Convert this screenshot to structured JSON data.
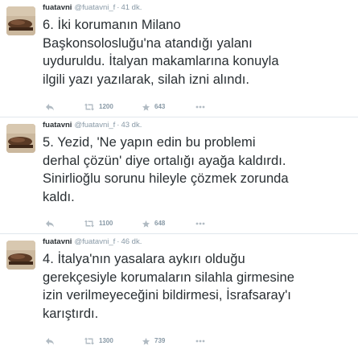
{
  "tweets": [
    {
      "fullname": "fuatavni",
      "username": "@fuatavni_f",
      "separator": "·",
      "time": "41 dk.",
      "text_lines": [
        "6. İki korumanın Milano",
        "Başkonsolosluğu'na atandığı yalanı",
        "uyduruldu. İtalyan makamlarına konuyla",
        "ilgili yazı yazılarak, silah izni alındı."
      ],
      "retweets": "1200",
      "favorites": "643"
    },
    {
      "fullname": "fuatavni",
      "username": "@fuatavni_f",
      "separator": "·",
      "time": "43 dk.",
      "text_lines": [
        "5. Yezid, 'Ne yapın edin bu problemi",
        "derhal çözün' diye ortalığı ayağa kaldırdı.",
        "Sinirlioğlu sorunu hileyle çözmek zorunda",
        "kaldı."
      ],
      "retweets": "1100",
      "favorites": "648"
    },
    {
      "fullname": "fuatavni",
      "username": "@fuatavni_f",
      "separator": "·",
      "time": "46 dk.",
      "text_lines": [
        "4. İtalya'nın yasalara aykırı olduğu",
        "gerekçesiyle korumaların silahla girmesine",
        "izin verilmeyeceğini bildirmesi, İsrafsaray'ı",
        "karıştırdı."
      ],
      "retweets": "1300",
      "favorites": "739"
    }
  ],
  "icons": {
    "avatar": "avatar-image",
    "reply": "reply-icon",
    "retweet": "retweet-icon",
    "favorite": "star-icon",
    "more": "more-icon"
  },
  "colors": {
    "text": "#292f33",
    "muted": "#8899a6",
    "divider": "#e1e8ed"
  }
}
